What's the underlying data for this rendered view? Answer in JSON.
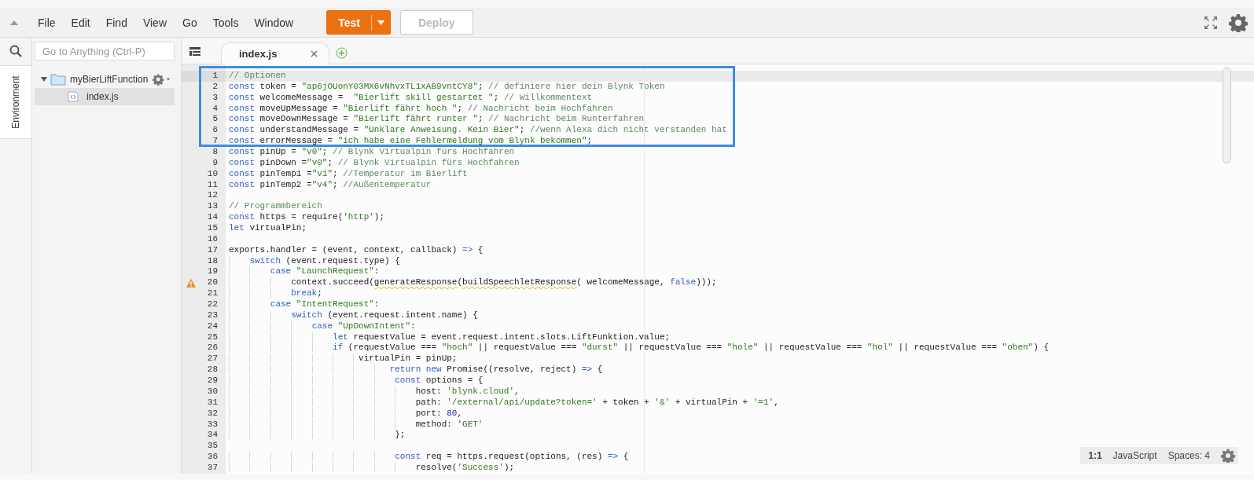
{
  "menu": [
    "File",
    "Edit",
    "Find",
    "View",
    "Go",
    "Tools",
    "Window"
  ],
  "toolbar_buttons": [
    {
      "label": "Test",
      "primary": true,
      "disabled": false,
      "kind": "split"
    },
    {
      "label": "Deploy",
      "primary": false,
      "disabled": true,
      "kind": "plain"
    }
  ],
  "side_tabs": [
    {
      "label": "Environment",
      "selected": true
    }
  ],
  "search": {
    "placeholder": "Go to Anything (Ctrl-P)"
  },
  "tree": [
    {
      "name": "myBierLiftFunction",
      "kind": "folder",
      "expanded": true,
      "selected": false,
      "children": [
        {
          "name": "index.js",
          "kind": "file",
          "selected": true
        }
      ]
    }
  ],
  "tabs": [
    {
      "label": "index.js",
      "selected": true
    }
  ],
  "code_lines": [
    {
      "number": "1",
      "current": true,
      "highlighted": true,
      "warning": false,
      "tokens": [
        {
          "kind": "comment",
          "text": "// Optionen"
        }
      ]
    },
    {
      "number": "2",
      "current": false,
      "highlighted": true,
      "warning": false,
      "tokens": [
        {
          "kind": "keyword",
          "text": "const"
        },
        {
          "kind": "plain",
          "text": " token = "
        },
        {
          "kind": "string",
          "text": "\"ap6jOUonY03MX6vNhvxTL1xAB9vntCY8\""
        },
        {
          "kind": "plain",
          "text": ";"
        },
        {
          "kind": "comment",
          "text": " // definiere hier dein Blynk Token"
        }
      ]
    },
    {
      "number": "3",
      "current": false,
      "highlighted": true,
      "warning": false,
      "tokens": [
        {
          "kind": "keyword",
          "text": "const"
        },
        {
          "kind": "plain",
          "text": " welcomeMessage =  "
        },
        {
          "kind": "string",
          "text": "\"Bierlift skill gestartet \""
        },
        {
          "kind": "plain",
          "text": ";"
        },
        {
          "kind": "comment",
          "text": " // Willkommentext"
        }
      ]
    },
    {
      "number": "4",
      "current": false,
      "highlighted": true,
      "warning": false,
      "tokens": [
        {
          "kind": "keyword",
          "text": "const"
        },
        {
          "kind": "plain",
          "text": " moveUpMessage = "
        },
        {
          "kind": "string",
          "text": "\"Bierlift fährt hoch \""
        },
        {
          "kind": "plain",
          "text": ";"
        },
        {
          "kind": "comment",
          "text": " // Nachricht beim Hochfahren"
        }
      ]
    },
    {
      "number": "5",
      "current": false,
      "highlighted": true,
      "warning": false,
      "tokens": [
        {
          "kind": "keyword",
          "text": "const"
        },
        {
          "kind": "plain",
          "text": " moveDownMessage = "
        },
        {
          "kind": "string",
          "text": "\"Bierlift fährt runter \""
        },
        {
          "kind": "plain",
          "text": ";"
        },
        {
          "kind": "comment",
          "text": " // Nachricht beim Runterfahren"
        }
      ]
    },
    {
      "number": "6",
      "current": false,
      "highlighted": true,
      "warning": false,
      "tokens": [
        {
          "kind": "keyword",
          "text": "const"
        },
        {
          "kind": "plain",
          "text": " understandMessage = "
        },
        {
          "kind": "string",
          "text": "\"Unklare Anweisung. Kein Bier\""
        },
        {
          "kind": "plain",
          "text": ";"
        },
        {
          "kind": "comment",
          "text": " //wenn Alexa dich nicht verstanden hat"
        }
      ]
    },
    {
      "number": "7",
      "current": false,
      "highlighted": true,
      "warning": false,
      "tokens": [
        {
          "kind": "keyword",
          "text": "const"
        },
        {
          "kind": "plain",
          "text": " errorMessage = "
        },
        {
          "kind": "string",
          "text": "\"ich habe eine Fehlermeldung vom Blynk bekommen\""
        },
        {
          "kind": "plain",
          "text": ";"
        }
      ]
    },
    {
      "number": "8",
      "current": false,
      "highlighted": false,
      "warning": false,
      "tokens": [
        {
          "kind": "keyword",
          "text": "const"
        },
        {
          "kind": "plain",
          "text": " pinUp = "
        },
        {
          "kind": "string",
          "text": "\"v0\""
        },
        {
          "kind": "plain",
          "text": ";"
        },
        {
          "kind": "comment",
          "text": " // Blynk Virtualpin fürs Hochfahren"
        }
      ]
    },
    {
      "number": "9",
      "current": false,
      "highlighted": false,
      "warning": false,
      "tokens": [
        {
          "kind": "keyword",
          "text": "const"
        },
        {
          "kind": "plain",
          "text": " pinDown ="
        },
        {
          "kind": "string",
          "text": "\"v0\""
        },
        {
          "kind": "plain",
          "text": ";"
        },
        {
          "kind": "comment",
          "text": " // Blynk Virtualpin fürs Hochfahren"
        }
      ]
    },
    {
      "number": "10",
      "current": false,
      "highlighted": false,
      "warning": false,
      "tokens": [
        {
          "kind": "keyword",
          "text": "const"
        },
        {
          "kind": "plain",
          "text": " pinTemp1 ="
        },
        {
          "kind": "string",
          "text": "\"v1\""
        },
        {
          "kind": "plain",
          "text": ";"
        },
        {
          "kind": "comment",
          "text": " //Temperatur im Bierlift"
        }
      ]
    },
    {
      "number": "11",
      "current": false,
      "highlighted": false,
      "warning": false,
      "tokens": [
        {
          "kind": "keyword",
          "text": "const"
        },
        {
          "kind": "plain",
          "text": " pinTemp2 ="
        },
        {
          "kind": "string",
          "text": "\"v4\""
        },
        {
          "kind": "plain",
          "text": ";"
        },
        {
          "kind": "comment",
          "text": " //Außentemperatur"
        }
      ]
    },
    {
      "number": "12",
      "current": false,
      "highlighted": false,
      "warning": false
    },
    {
      "number": "13",
      "current": false,
      "highlighted": false,
      "warning": false,
      "tokens": [
        {
          "kind": "comment",
          "text": "// Programmbereich"
        }
      ]
    },
    {
      "number": "14",
      "current": false,
      "highlighted": false,
      "warning": false,
      "tokens": [
        {
          "kind": "keyword",
          "text": "const"
        },
        {
          "kind": "plain",
          "text": " https = require("
        },
        {
          "kind": "string",
          "text": "'http'"
        },
        {
          "kind": "plain",
          "text": ");"
        }
      ]
    },
    {
      "number": "15",
      "current": false,
      "highlighted": false,
      "warning": false,
      "tokens": [
        {
          "kind": "keyword",
          "text": "let"
        },
        {
          "kind": "plain",
          "text": " virtualPin;"
        }
      ]
    },
    {
      "number": "16",
      "current": false,
      "highlighted": false,
      "warning": false
    },
    {
      "number": "17",
      "current": false,
      "highlighted": false,
      "warning": false,
      "tokens": [
        {
          "kind": "plain",
          "text": "exports.handler = (event, context, callback)"
        },
        {
          "kind": "keyword",
          "text": " =>"
        },
        {
          "kind": "plain",
          "text": " {"
        }
      ]
    },
    {
      "number": "18",
      "current": false,
      "highlighted": false,
      "warning": false,
      "tokens": [
        {
          "kind": "keyword",
          "text": "    switch"
        },
        {
          "kind": "plain",
          "text": " (event.request.type) {"
        }
      ]
    },
    {
      "number": "19",
      "current": false,
      "highlighted": false,
      "warning": false,
      "tokens": [
        {
          "kind": "keyword",
          "text": "        case"
        },
        {
          "kind": "string",
          "text": " \"LaunchRequest\""
        },
        {
          "kind": "plain",
          "text": ":"
        }
      ]
    },
    {
      "number": "20",
      "current": false,
      "highlighted": false,
      "warning": true,
      "tokens": [
        {
          "kind": "plain",
          "text": "            context.succeed("
        },
        {
          "kind": "flagged",
          "text": "generateResponse"
        },
        {
          "kind": "plain",
          "text": "("
        },
        {
          "kind": "flagged",
          "text": "buildSpeechletResponse"
        },
        {
          "kind": "plain",
          "text": "( welcomeMessage,"
        },
        {
          "kind": "keyword",
          "text": " false"
        },
        {
          "kind": "plain",
          "text": ")));"
        }
      ]
    },
    {
      "number": "21",
      "current": false,
      "highlighted": false,
      "warning": false,
      "tokens": [
        {
          "kind": "keyword",
          "text": "            break"
        },
        {
          "kind": "plain",
          "text": ";"
        }
      ]
    },
    {
      "number": "22",
      "current": false,
      "highlighted": false,
      "warning": false,
      "tokens": [
        {
          "kind": "keyword",
          "text": "        case"
        },
        {
          "kind": "string",
          "text": " \"IntentRequest\""
        },
        {
          "kind": "plain",
          "text": ":"
        }
      ]
    },
    {
      "number": "23",
      "current": false,
      "highlighted": false,
      "warning": false,
      "tokens": [
        {
          "kind": "keyword",
          "text": "            switch"
        },
        {
          "kind": "plain",
          "text": " (event.request.intent.name) {"
        }
      ]
    },
    {
      "number": "24",
      "current": false,
      "highlighted": false,
      "warning": false,
      "tokens": [
        {
          "kind": "keyword",
          "text": "                case"
        },
        {
          "kind": "string",
          "text": " \"UpDownIntent\""
        },
        {
          "kind": "plain",
          "text": ":"
        }
      ]
    },
    {
      "number": "25",
      "current": false,
      "highlighted": false,
      "warning": false,
      "tokens": [
        {
          "kind": "keyword",
          "text": "                    let"
        },
        {
          "kind": "plain",
          "text": " requestValue = event.request.intent.slots.LiftFunktion.value;"
        }
      ]
    },
    {
      "number": "26",
      "current": false,
      "highlighted": false,
      "warning": false,
      "tokens": [
        {
          "kind": "keyword",
          "text": "                    if"
        },
        {
          "kind": "plain",
          "text": " (requestValue === "
        },
        {
          "kind": "string",
          "text": "\"hoch\""
        },
        {
          "kind": "plain",
          "text": " || requestValue === "
        },
        {
          "kind": "string",
          "text": "\"durst\""
        },
        {
          "kind": "plain",
          "text": " || requestValue === "
        },
        {
          "kind": "string",
          "text": "\"hole\""
        },
        {
          "kind": "plain",
          "text": " || requestValue === "
        },
        {
          "kind": "string",
          "text": "\"hol\""
        },
        {
          "kind": "plain",
          "text": " || requestValue === "
        },
        {
          "kind": "string",
          "text": "\"oben\""
        },
        {
          "kind": "plain",
          "text": ") {"
        }
      ]
    },
    {
      "number": "27",
      "current": false,
      "highlighted": false,
      "warning": false,
      "tokens": [
        {
          "kind": "plain",
          "text": "                         virtualPin = pinUp;"
        }
      ]
    },
    {
      "number": "28",
      "current": false,
      "highlighted": false,
      "warning": false,
      "tokens": [
        {
          "kind": "keyword",
          "text": "                               return"
        },
        {
          "kind": "keyword",
          "text": " new"
        },
        {
          "kind": "plain",
          "text": " Promise((resolve, reject)"
        },
        {
          "kind": "keyword",
          "text": " =>"
        },
        {
          "kind": "plain",
          "text": " {"
        }
      ]
    },
    {
      "number": "29",
      "current": false,
      "highlighted": false,
      "warning": false,
      "tokens": [
        {
          "kind": "keyword",
          "text": "                                const"
        },
        {
          "kind": "plain",
          "text": " options = {"
        }
      ]
    },
    {
      "number": "30",
      "current": false,
      "highlighted": false,
      "warning": false,
      "tokens": [
        {
          "kind": "plain",
          "text": "                                    host: "
        },
        {
          "kind": "string",
          "text": "'blynk.cloud'"
        },
        {
          "kind": "plain",
          "text": ","
        }
      ]
    },
    {
      "number": "31",
      "current": false,
      "highlighted": false,
      "warning": false,
      "tokens": [
        {
          "kind": "plain",
          "text": "                                    path: "
        },
        {
          "kind": "string",
          "text": "'/external/api/update?token='"
        },
        {
          "kind": "plain",
          "text": " + token + "
        },
        {
          "kind": "string",
          "text": "'&'"
        },
        {
          "kind": "plain",
          "text": " + virtualPin + "
        },
        {
          "kind": "string",
          "text": "'=1'"
        },
        {
          "kind": "plain",
          "text": ","
        }
      ]
    },
    {
      "number": "32",
      "current": false,
      "highlighted": false,
      "warning": false,
      "tokens": [
        {
          "kind": "plain",
          "text": "                                    port: "
        },
        {
          "kind": "number",
          "text": "80"
        },
        {
          "kind": "plain",
          "text": ","
        }
      ]
    },
    {
      "number": "33",
      "current": false,
      "highlighted": false,
      "warning": false,
      "tokens": [
        {
          "kind": "plain",
          "text": "                                    method: "
        },
        {
          "kind": "string",
          "text": "'GET'"
        }
      ]
    },
    {
      "number": "34",
      "current": false,
      "highlighted": false,
      "warning": false,
      "tokens": [
        {
          "kind": "plain",
          "text": "                                };"
        }
      ]
    },
    {
      "number": "35",
      "current": false,
      "highlighted": false,
      "warning": false
    },
    {
      "number": "36",
      "current": false,
      "highlighted": false,
      "warning": false,
      "tokens": [
        {
          "kind": "keyword",
          "text": "                                const"
        },
        {
          "kind": "plain",
          "text": " req = https.request(options, (res)"
        },
        {
          "kind": "keyword",
          "text": " =>"
        },
        {
          "kind": "plain",
          "text": " {"
        }
      ]
    },
    {
      "number": "37",
      "current": false,
      "highlighted": false,
      "warning": false,
      "tokens": [
        {
          "kind": "plain",
          "text": "                                    resolve("
        },
        {
          "kind": "string",
          "text": "'Success'"
        },
        {
          "kind": "plain",
          "text": ");"
        }
      ]
    }
  ],
  "status_bar": {
    "position": "1:1",
    "language": "JavaScript",
    "indentation": "Spaces: 4"
  }
}
